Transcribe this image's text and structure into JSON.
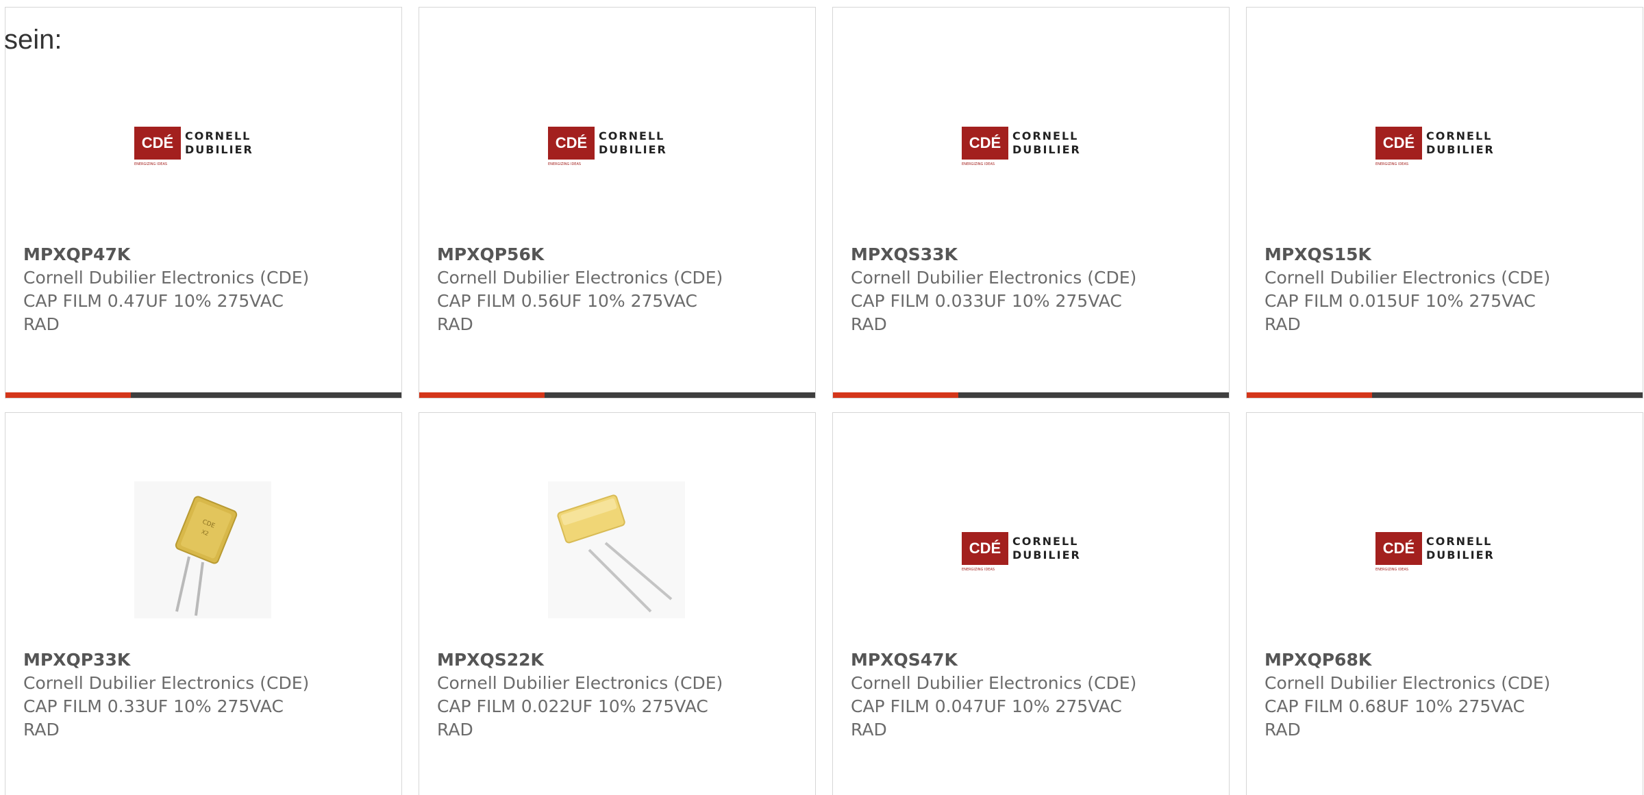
{
  "intro_text": "sein:",
  "logo": {
    "mark": "CDÉ",
    "line1": "CORNELL",
    "line2": "DUBILIER",
    "tagline": "ENERGIZING IDEAS",
    "brand_color": "#a3201e"
  },
  "accent_colors": {
    "bar_accent": "#d4361a",
    "bar_dark": "#3f3f3f"
  },
  "products": [
    {
      "part": "MPXQP47K",
      "maker": "Cornell Dubilier Electronics (CDE)",
      "desc": "CAP FILM 0.47UF 10% 275VAC RAD",
      "image": "cde-logo"
    },
    {
      "part": "MPXQP56K",
      "maker": "Cornell Dubilier Electronics (CDE)",
      "desc": "CAP FILM 0.56UF 10% 275VAC RAD",
      "image": "cde-logo"
    },
    {
      "part": "MPXQS33K",
      "maker": "Cornell Dubilier Electronics (CDE)",
      "desc": "CAP FILM 0.033UF 10% 275VAC RAD",
      "image": "cde-logo"
    },
    {
      "part": "MPXQS15K",
      "maker": "Cornell Dubilier Electronics (CDE)",
      "desc": "CAP FILM 0.015UF 10% 275VAC RAD",
      "image": "cde-logo"
    },
    {
      "part": "MPXQP33K",
      "maker": "Cornell Dubilier Electronics (CDE)",
      "desc": "CAP FILM 0.33UF 10% 275VAC RAD",
      "image": "capacitor-photo-large"
    },
    {
      "part": "MPXQS22K",
      "maker": "Cornell Dubilier Electronics (CDE)",
      "desc": "CAP FILM 0.022UF 10% 275VAC RAD",
      "image": "capacitor-photo-small"
    },
    {
      "part": "MPXQS47K",
      "maker": "Cornell Dubilier Electronics (CDE)",
      "desc": "CAP FILM 0.047UF 10% 275VAC RAD",
      "image": "cde-logo"
    },
    {
      "part": "MPXQP68K",
      "maker": "Cornell Dubilier Electronics (CDE)",
      "desc": "CAP FILM 0.68UF 10% 275VAC RAD",
      "image": "cde-logo"
    }
  ]
}
